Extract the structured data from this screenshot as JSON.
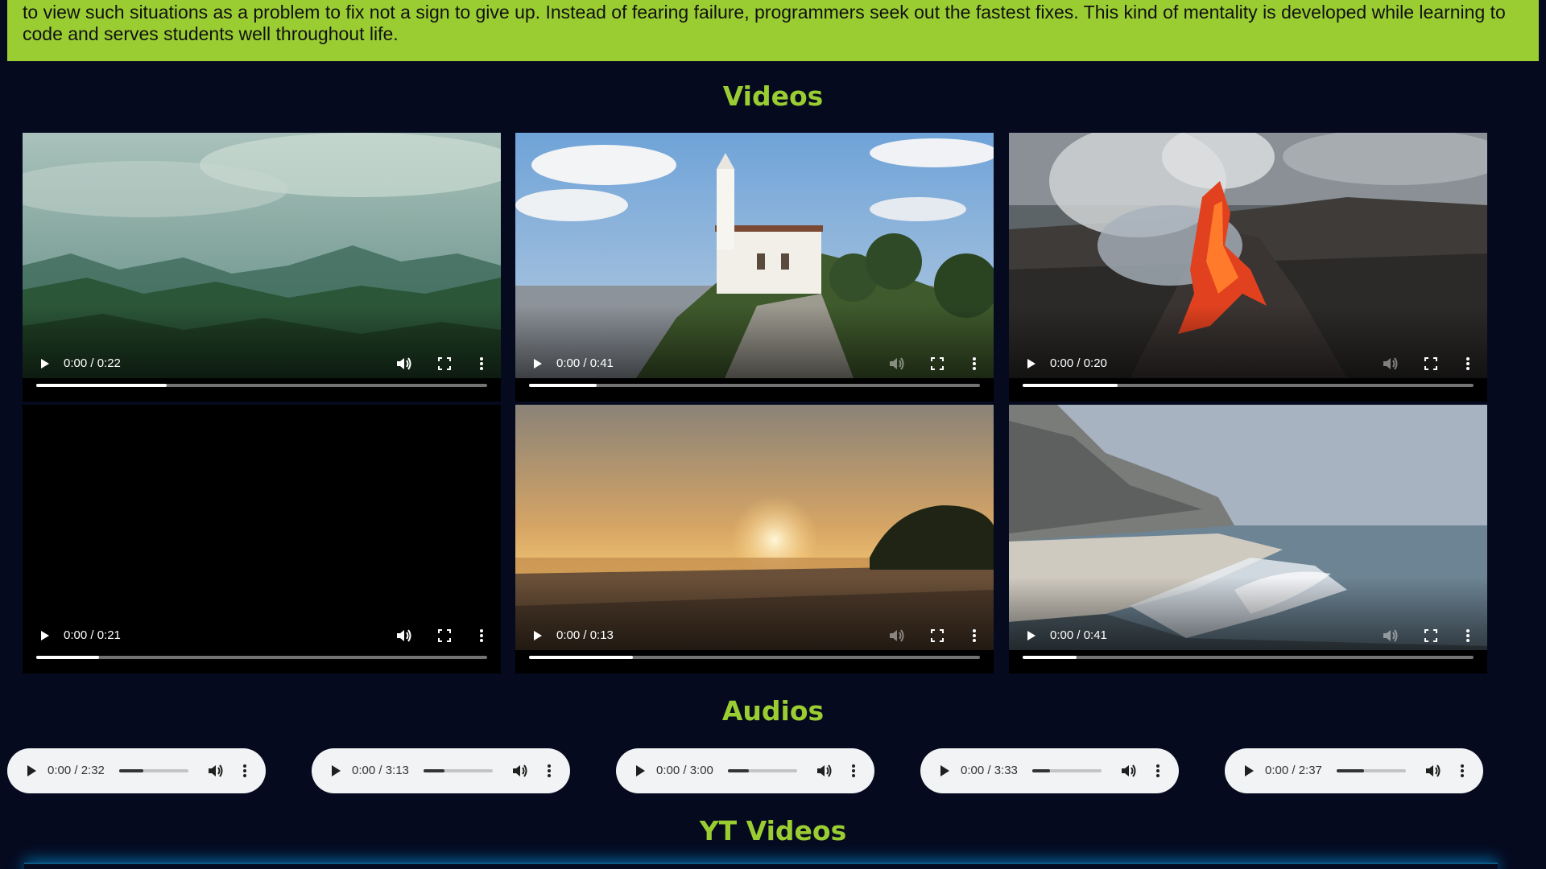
{
  "intro": {
    "text": "to view such situations as a problem to fix not a sign to give up. Instead of fearing failure, programmers seek out the fastest fixes. This kind of mentality is developed while learning to code and serves students well throughout life."
  },
  "sections": {
    "videos_title": "Videos",
    "audios_title": "Audios",
    "yt_title": "YT Videos"
  },
  "colors": {
    "page_bg": "#050a1f",
    "accent": "#9acd32",
    "audio_player_bg": "#f1f3f4"
  },
  "videos": [
    {
      "scene": "misty-green-mountains",
      "time": "0:00 / 0:22",
      "buffered": 0.29
    },
    {
      "scene": "hilltop-church-monserrate",
      "time": "0:00 / 0:41",
      "buffered": 0.15
    },
    {
      "scene": "erupting-volcano-lava",
      "time": "0:00 / 0:20",
      "buffered": 0.21
    },
    {
      "scene": "black-unloaded",
      "time": "0:00 / 0:21",
      "buffered": 0.14
    },
    {
      "scene": "sunset-beach",
      "time": "0:00 / 0:13",
      "buffered": 0.23
    },
    {
      "scene": "coastal-cliffs-waves",
      "time": "0:00 / 0:41",
      "buffered": 0.12
    }
  ],
  "audios": [
    {
      "time": "0:00 / 2:32",
      "volume": 0.35
    },
    {
      "time": "0:00 / 3:13",
      "volume": 0.3
    },
    {
      "time": "0:00 / 3:00",
      "volume": 0.3
    },
    {
      "time": "0:00 / 3:33",
      "volume": 0.25
    },
    {
      "time": "0:00 / 2:37",
      "volume": 0.4
    }
  ]
}
